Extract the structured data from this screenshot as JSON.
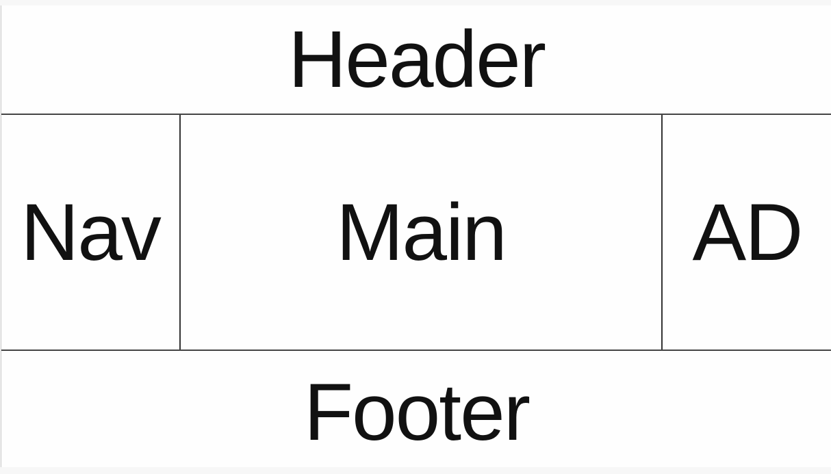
{
  "layout": {
    "header": "Header",
    "nav": "Nav",
    "main": "Main",
    "ad": "AD",
    "footer": "Footer"
  }
}
